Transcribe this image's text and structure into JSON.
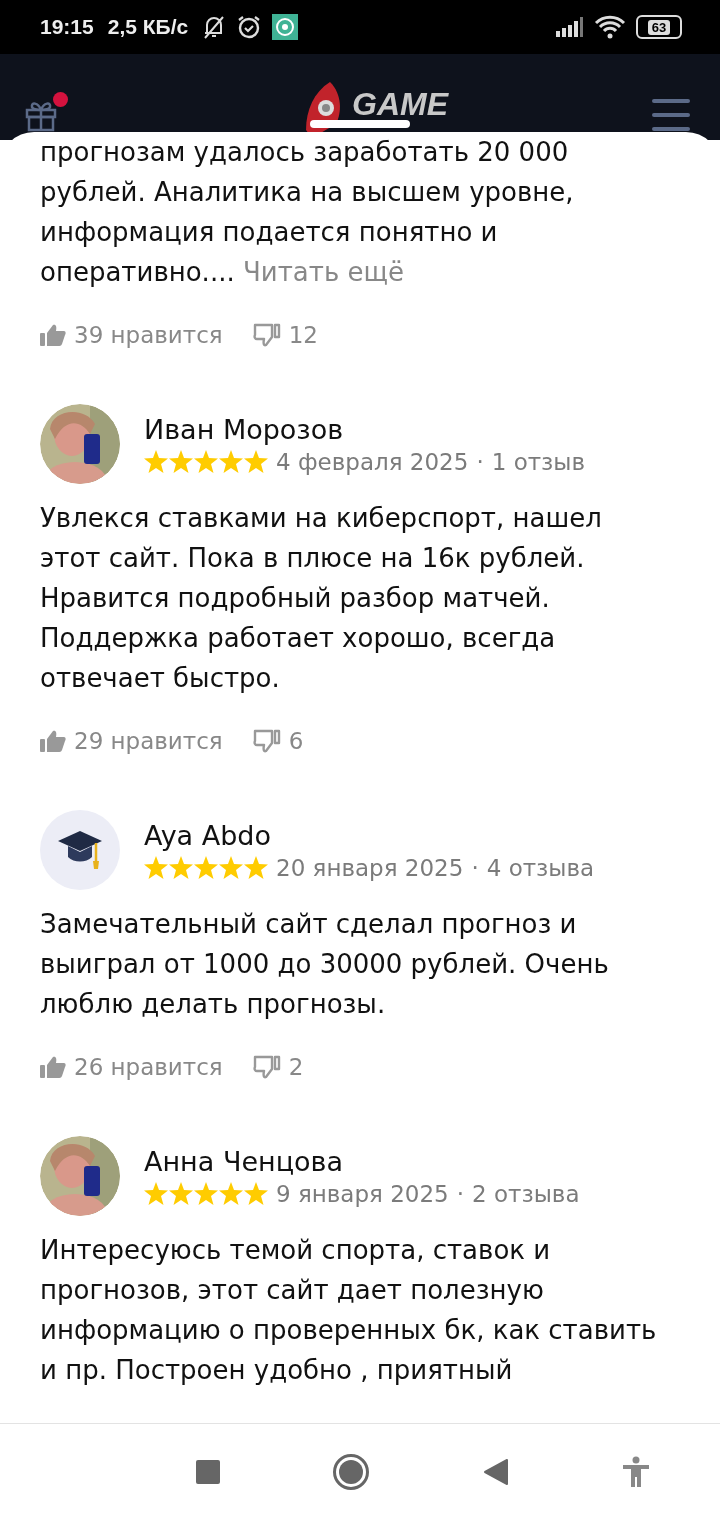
{
  "status_bar": {
    "time": "19:15",
    "speed": "2,5 КБ/с",
    "battery": "63"
  },
  "header": {
    "logo_top": "GAME",
    "notification": true
  },
  "reviews": [
    {
      "text": "прогнозам удалось заработать 20 000 рублей. Аналитика на высшем уровне, информация подается понятно и оперативно....",
      "more": "Читать ещё",
      "likes": "39 нравится",
      "dislikes": "12"
    },
    {
      "author": "Иван Морозов",
      "stars": 5,
      "date": "4 февраля 2025",
      "separator": "·",
      "count": "1 отзыв",
      "text": "Увлекся ставками на киберспорт, нашел этот сайт. Пока в плюсе на 16к рублей. Нравится подробный разбор матчей. Поддержка работает хорошо, всегда отвечает быстро.",
      "likes": "29 нравится",
      "dislikes": "6"
    },
    {
      "author": "Aya Abdo",
      "avatar": {
        "kind": "icon"
      },
      "stars": 5,
      "separator": "·",
      "date": "20 января 2025",
      "count": "4 отзыва",
      "text": "Замечательный сайт сделал прогноз и выиграл от 1000 до 30000 рублей. Очень люблю делать прогнозы.",
      "likes": "26 нравится",
      "dislikes": "2"
    },
    {
      "author": "Анна Ченцова",
      "stars": 5,
      "date": "9 января 2025",
      "separator": "·",
      "count": "2 отзыва",
      "text": "Интересуюсь темой спорта, ставок  и прогнозов, этот сайт дает полезную информацию о проверенных бк, как ставить и пр. Построен удобно , приятный"
    }
  ]
}
